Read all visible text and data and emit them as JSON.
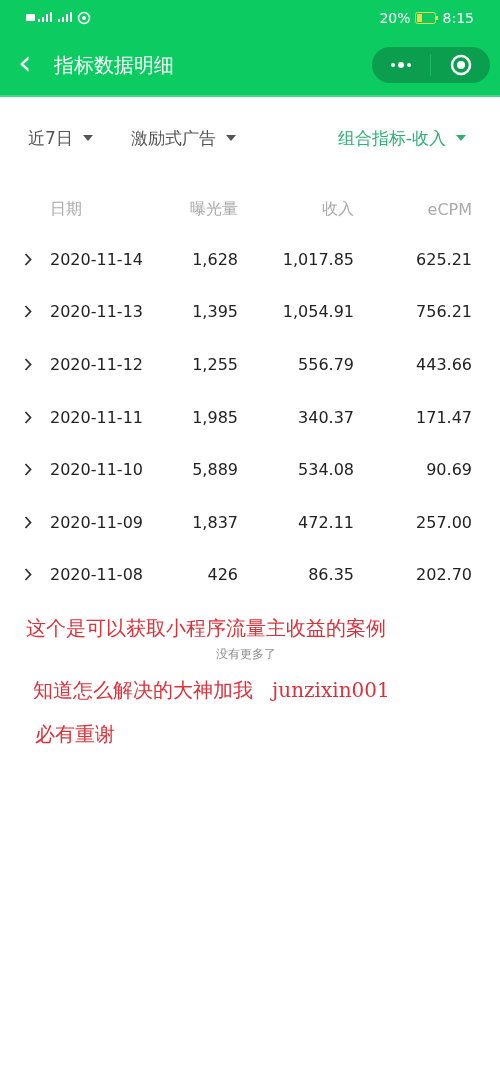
{
  "status_bar": {
    "battery_text": "20%",
    "time": "8:15"
  },
  "header": {
    "back": "‹",
    "title": "指标数据明细"
  },
  "filters": [
    {
      "label": "近7日",
      "active": false
    },
    {
      "label": "激励式广告",
      "active": false
    },
    {
      "label": "组合指标-收入",
      "active": true
    }
  ],
  "table": {
    "columns": [
      "日期",
      "曝光量",
      "收入",
      "eCPM"
    ],
    "rows": [
      {
        "cells": [
          "2020-11-14",
          "1,628",
          "1,017.85",
          "625.21"
        ],
        "expanded": false
      },
      {
        "cells": [
          "2020-11-13",
          "1,395",
          "1,054.91",
          "756.21"
        ],
        "expanded": false
      },
      {
        "cells": [
          "2020-11-12",
          "1,255",
          "556.79",
          "443.66"
        ],
        "expanded": false
      },
      {
        "cells": [
          "2020-11-11",
          "1,985",
          "340.37",
          "171.47"
        ],
        "expanded": false
      },
      {
        "cells": [
          "2020-11-10",
          "5,889",
          "534.08",
          "90.69"
        ],
        "expanded": false
      },
      {
        "cells": [
          "2020-11-09",
          "1,837",
          "472.11",
          "257.00"
        ],
        "expanded": false
      },
      {
        "cells": [
          "2020-11-08",
          "426",
          "86.35",
          "202.70"
        ],
        "expanded": false
      }
    ]
  },
  "annotations": [
    {
      "text": "这个是可以获取小程序流量主收益的案例"
    },
    {
      "text": "知道怎么解决的大神加我   junzixin001"
    },
    {
      "text": "必有重谢"
    }
  ],
  "footer_hint": "没有更多了"
}
